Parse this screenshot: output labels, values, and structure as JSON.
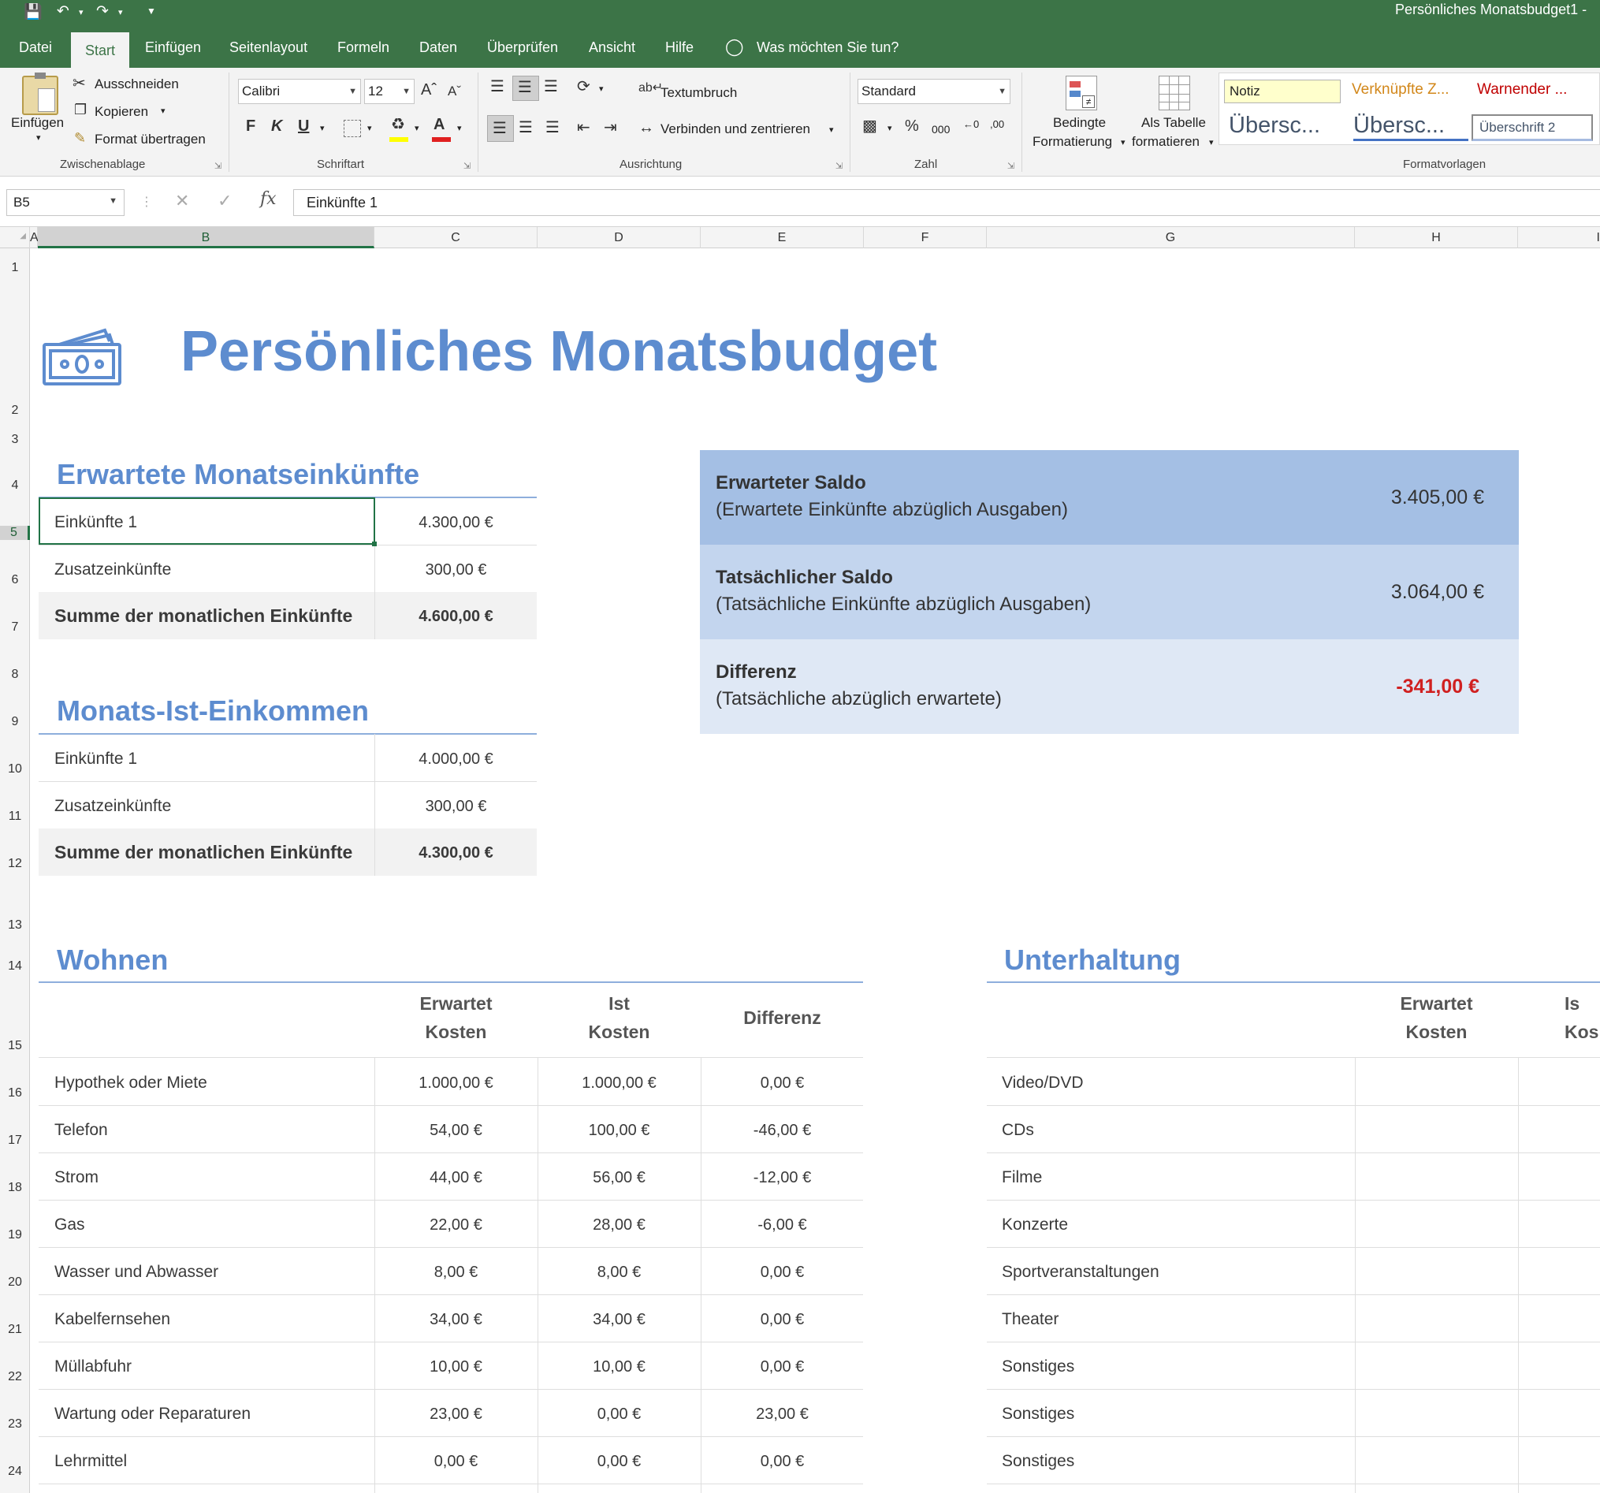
{
  "window": {
    "title": "Persönliches Monatsbudget1  -"
  },
  "tabs": [
    "Datei",
    "Start",
    "Einfügen",
    "Seitenlayout",
    "Formeln",
    "Daten",
    "Überprüfen",
    "Ansicht",
    "Hilfe"
  ],
  "tell_me": "Was möchten Sie tun?",
  "ribbon": {
    "clipboard": {
      "paste": "Einfügen",
      "cut": "Ausschneiden",
      "copy": "Kopieren",
      "format_painter": "Format übertragen",
      "label": "Zwischenablage"
    },
    "font": {
      "name": "Calibri",
      "size": "12",
      "bold": "F",
      "italic": "K",
      "underline": "U",
      "label": "Schriftart"
    },
    "alignment": {
      "wrap": "Textumbruch",
      "merge": "Verbinden und zentrieren",
      "label": "Ausrichtung"
    },
    "number": {
      "format": "Standard",
      "percent": "%",
      "thousands": "000",
      "label": "Zahl"
    },
    "styles": {
      "conditional_1": "Bedingte",
      "conditional_2": "Formatierung",
      "as_table_1": "Als Tabelle",
      "as_table_2": "formatieren",
      "notiz": "Notiz",
      "verknuepft": "Verknüpfte Z...",
      "warnender": "Warnender ...",
      "ueberschrift_a": "Übersc...",
      "ueberschrift_b": "Übersc...",
      "ueberschrift_2": "Überschrift 2",
      "label": "Formatvorlagen"
    }
  },
  "formula_bar": {
    "cell_ref": "B5",
    "fx": "fx",
    "content": "Einkünfte 1"
  },
  "columns": [
    "A",
    "B",
    "C",
    "D",
    "E",
    "F",
    "G",
    "H",
    "I"
  ],
  "rows": [
    "1",
    "2",
    "3",
    "4",
    "5",
    "6",
    "7",
    "8",
    "9",
    "10",
    "11",
    "12",
    "13",
    "14",
    "15",
    "16",
    "17",
    "18",
    "19",
    "20",
    "21",
    "22",
    "23",
    "24"
  ],
  "sheet": {
    "title": "Persönliches Monatsbudget",
    "expected_income": {
      "heading": "Erwartete Monatseinkünfte",
      "rows": [
        {
          "label": "Einkünfte 1",
          "value": "4.300,00 €"
        },
        {
          "label": "Zusatzeinkünfte",
          "value": "300,00 €"
        }
      ],
      "total": {
        "label": "Summe der monatlichen Einkünfte",
        "value": "4.600,00 €"
      }
    },
    "actual_income": {
      "heading": "Monats-Ist-Einkommen",
      "rows": [
        {
          "label": "Einkünfte 1",
          "value": "4.000,00 €"
        },
        {
          "label": "Zusatzeinkünfte",
          "value": "300,00 €"
        }
      ],
      "total": {
        "label": "Summe der monatlichen Einkünfte",
        "value": "4.300,00 €"
      }
    },
    "summary": [
      {
        "title": "Erwarteter Saldo",
        "subtitle": "(Erwartete Einkünfte abzüglich Ausgaben)",
        "value": "3.405,00 €",
        "bg": "#a4bfe4"
      },
      {
        "title": "Tatsächlicher Saldo",
        "subtitle": "(Tatsächliche Einkünfte abzüglich Ausgaben)",
        "value": "3.064,00 €",
        "bg": "#c3d5ee"
      },
      {
        "title": "Differenz",
        "subtitle": "(Tatsächliche abzüglich erwartete)",
        "value": "-341,00 €",
        "bg": "#dfe8f5",
        "value_color": "#d02020"
      }
    ],
    "housing": {
      "heading": "Wohnen",
      "col_expected": [
        "Erwartet",
        "Kosten"
      ],
      "col_actual": [
        "Ist",
        "Kosten"
      ],
      "col_diff": "Differenz",
      "rows": [
        {
          "label": "Hypothek oder Miete",
          "expected": "1.000,00 €",
          "actual": "1.000,00 €",
          "diff": "0,00 €"
        },
        {
          "label": "Telefon",
          "expected": "54,00 €",
          "actual": "100,00 €",
          "diff": "-46,00 €"
        },
        {
          "label": "Strom",
          "expected": "44,00 €",
          "actual": "56,00 €",
          "diff": "-12,00 €"
        },
        {
          "label": "Gas",
          "expected": "22,00 €",
          "actual": "28,00 €",
          "diff": "-6,00 €"
        },
        {
          "label": "Wasser und Abwasser",
          "expected": "8,00 €",
          "actual": "8,00 €",
          "diff": "0,00 €"
        },
        {
          "label": "Kabelfernsehen",
          "expected": "34,00 €",
          "actual": "34,00 €",
          "diff": "0,00 €"
        },
        {
          "label": "Müllabfuhr",
          "expected": "10,00 €",
          "actual": "10,00 €",
          "diff": "0,00 €"
        },
        {
          "label": "Wartung oder Reparaturen",
          "expected": "23,00 €",
          "actual": "0,00 €",
          "diff": "23,00 €"
        },
        {
          "label": "Lehrmittel",
          "expected": "0,00 €",
          "actual": "0,00 €",
          "diff": "0,00 €"
        }
      ]
    },
    "entertainment": {
      "heading": "Unterhaltung",
      "col_expected": [
        "Erwartet",
        "Kosten"
      ],
      "col_actual": [
        "Is",
        "Kos"
      ],
      "rows": [
        "Video/DVD",
        "CDs",
        "Filme",
        "Konzerte",
        "Sportveranstaltungen",
        "Theater",
        "Sonstiges",
        "Sonstiges",
        "Sonstiges"
      ]
    }
  }
}
